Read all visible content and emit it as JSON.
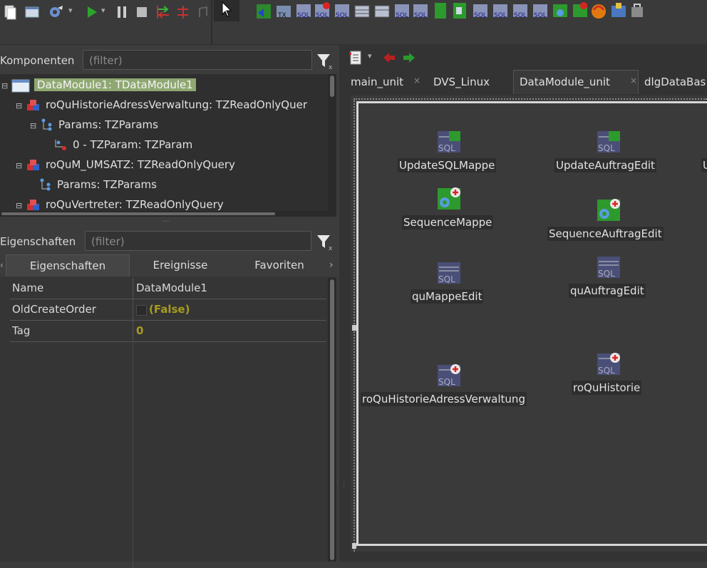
{
  "toolbar": {
    "icons": [
      "new-unit-icon",
      "new-form-icon",
      "build-settings-icon",
      "run-icon",
      "pause-icon",
      "stop-icon",
      "step-into-icon",
      "step-over-icon",
      "step-out-icon",
      "select-pointer-icon"
    ]
  },
  "components_panel": {
    "title": "Komponenten",
    "filter_placeholder": "(filter)",
    "tree": [
      {
        "label": "DataModule1: TDataModule1",
        "icon": "datamodule-icon",
        "selected": true
      },
      {
        "label": "roQuHistorieAdressVerwaltung: TZReadOnlyQuer",
        "icon": "query-component-icon"
      },
      {
        "label": "Params: TZParams",
        "icon": "params-icon"
      },
      {
        "label": "0 - TZParam: TZParam",
        "icon": "param-icon"
      },
      {
        "label": "roQuM_UMSATZ: TZReadOnlyQuery",
        "icon": "query-component-icon"
      },
      {
        "label": "Params: TZParams",
        "icon": "params-icon"
      },
      {
        "label": "roQuVertreter: TZReadOnlyQuery",
        "icon": "query-component-icon"
      }
    ]
  },
  "properties_panel": {
    "title": "Eigenschaften",
    "filter_placeholder": "(filter)",
    "tabs": [
      "Eigenschaften",
      "Ereignisse",
      "Favoriten"
    ],
    "rows": [
      {
        "name": "Name",
        "value": "DataModule1"
      },
      {
        "name": "OldCreateOrder",
        "value": "(False)"
      },
      {
        "name": "Tag",
        "value": "0"
      }
    ]
  },
  "editor": {
    "tabs": [
      "main_unit",
      "DVS_Linux",
      "DataModule_unit",
      "dlgDataBas"
    ],
    "active_tab": "DataModule_unit",
    "components": [
      {
        "label": "UpdateSQLMappe",
        "icon": "sql-update-icon"
      },
      {
        "label": "UpdateAuftragEdit",
        "icon": "sql-update-icon"
      },
      {
        "label": "SequenceMappe",
        "icon": "sequence-icon"
      },
      {
        "label": "SequenceAuftragEdit",
        "icon": "sequence-icon"
      },
      {
        "label": "quMappeEdit",
        "icon": "sql-query-icon"
      },
      {
        "label": "quAuftragEdit",
        "icon": "sql-query-icon"
      },
      {
        "label": "roQuHistorieAdressVerwaltung",
        "icon": "sql-readonly-query-icon"
      },
      {
        "label": "roQuHistorie",
        "icon": "sql-readonly-query-icon"
      }
    ],
    "partial_labels": [
      "U"
    ]
  },
  "colors": {
    "background": "#3c3c3c",
    "selection": "#8fa872",
    "grid_value": "#b0a020"
  }
}
